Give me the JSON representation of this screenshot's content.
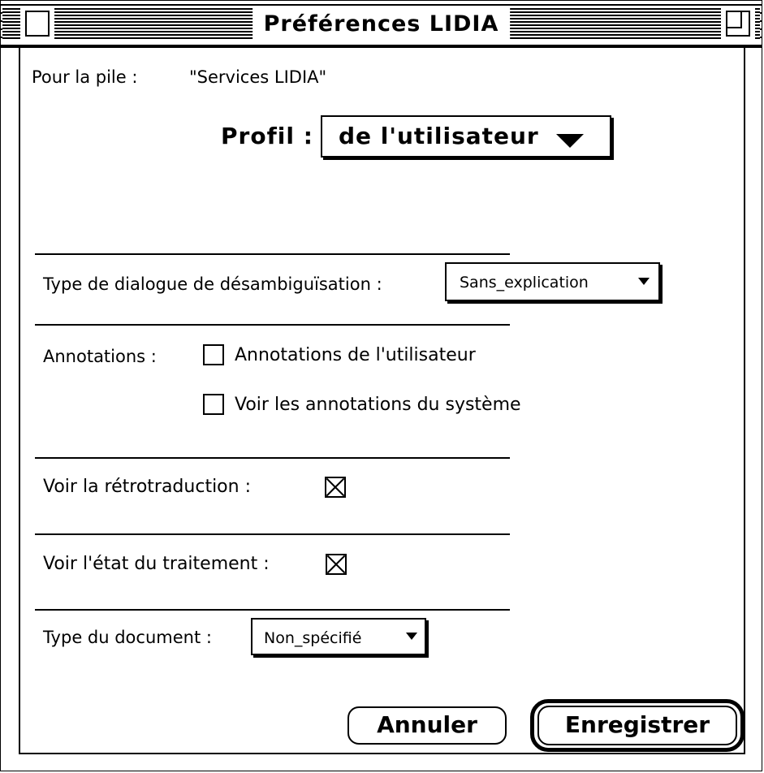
{
  "window": {
    "title": "Préférences LIDIA"
  },
  "stack": {
    "label": "Pour la pile :",
    "value": "\"Services LIDIA\""
  },
  "profile": {
    "label": "Profil :",
    "selected": "de l'utilisateur"
  },
  "disambiguation": {
    "label": "Type de dialogue de désambiguïsation :",
    "selected": "Sans_explication"
  },
  "annotations": {
    "label": "Annotations :",
    "user_label": "Annotations de l'utilisateur",
    "user_checked": false,
    "system_label": "Voir les annotations du système",
    "system_checked": false
  },
  "back_translation": {
    "label": "Voir la rétrotraduction :",
    "checked": true
  },
  "processing_state": {
    "label": "Voir l'état du traitement :",
    "checked": true
  },
  "document_type": {
    "label": "Type du document :",
    "selected": "Non_spécifié"
  },
  "buttons": {
    "cancel": "Annuler",
    "save": "Enregistrer"
  },
  "icons": {
    "close": "close-box-icon",
    "zoom": "zoom-box-icon",
    "dropdown": "triangle-down-icon",
    "check": "x-check-icon"
  }
}
